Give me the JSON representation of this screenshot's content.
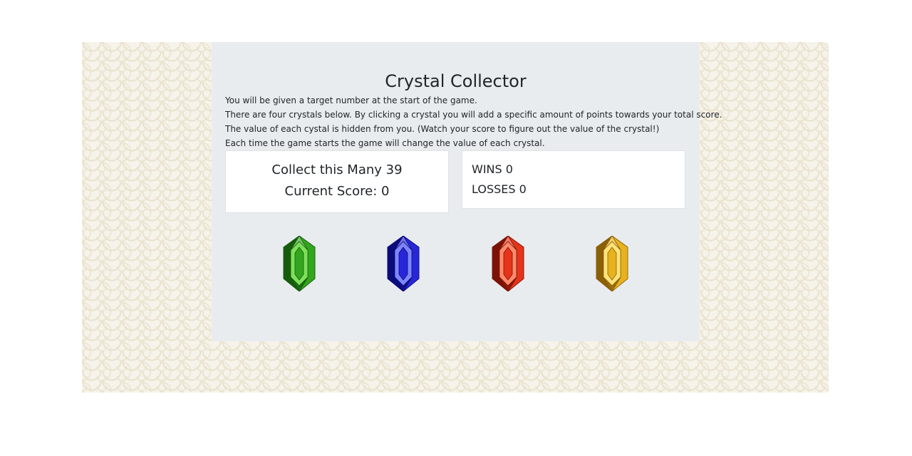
{
  "game": {
    "title": "Crystal Collector",
    "instructions": [
      "You will be given a target number at the start of the game.",
      "There are four crystals below. By clicking a crystal you will add a specific amount of points towards your total score.",
      "The value of each cystal is hidden from you. (Watch your score to figure out the value of the crystal!)",
      "Each time the game starts the game will change the value of each crystal."
    ],
    "target_label": "Collect this Many",
    "target_value": "39",
    "score_label": "Current Score:",
    "score_value": "0",
    "wins_label": "WINS",
    "wins_value": "0",
    "losses_label": "LOSSES",
    "losses_value": "0"
  },
  "crystals": [
    {
      "name": "green-crystal",
      "colors": {
        "light": "#7ee05a",
        "mid": "#33a51f",
        "dark": "#165c0c"
      }
    },
    {
      "name": "blue-crystal",
      "colors": {
        "light": "#7e86ff",
        "mid": "#2727d9",
        "dark": "#0b0b7a"
      }
    },
    {
      "name": "red-crystal",
      "colors": {
        "light": "#ff8a6a",
        "mid": "#e5341a",
        "dark": "#7a1206"
      }
    },
    {
      "name": "yellow-crystal",
      "colors": {
        "light": "#ffe27a",
        "mid": "#e6b21e",
        "dark": "#8a5f08"
      }
    }
  ],
  "colors": {
    "panel_bg": "#e9ecef",
    "box_bg": "#ffffff",
    "text": "#212529"
  }
}
